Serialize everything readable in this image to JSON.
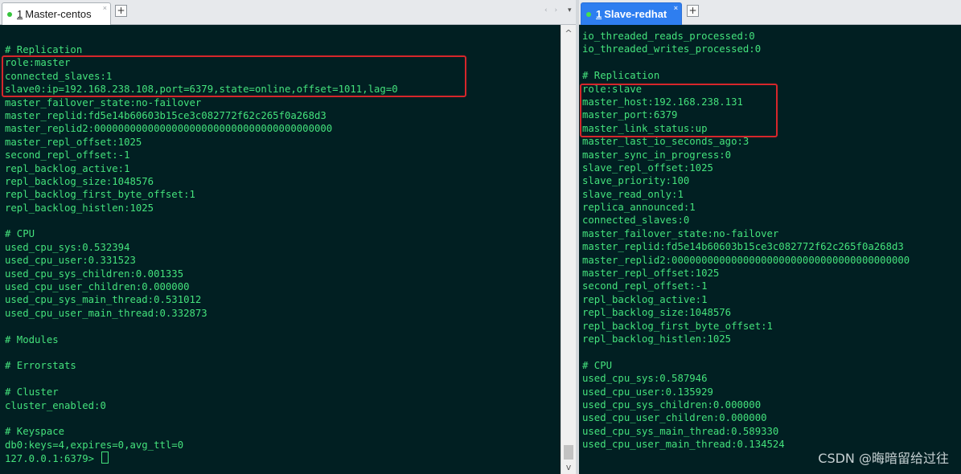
{
  "left": {
    "tab": {
      "number": "1",
      "title": "Master-centos",
      "close": "×"
    },
    "add_tab": "+",
    "tab_nav": "‹ ›",
    "tab_menu": "▾",
    "lines": [
      "# Replication",
      "role:master",
      "connected_slaves:1",
      "slave0:ip=192.168.238.108,port=6379,state=online,offset=1011,lag=0",
      "master_failover_state:no-failover",
      "master_replid:fd5e14b60603b15ce3c082772f62c265f0a268d3",
      "master_replid2:0000000000000000000000000000000000000000",
      "master_repl_offset:1025",
      "second_repl_offset:-1",
      "repl_backlog_active:1",
      "repl_backlog_size:1048576",
      "repl_backlog_first_byte_offset:1",
      "repl_backlog_histlen:1025",
      "",
      "# CPU",
      "used_cpu_sys:0.532394",
      "used_cpu_user:0.331523",
      "used_cpu_sys_children:0.001335",
      "used_cpu_user_children:0.000000",
      "used_cpu_sys_main_thread:0.531012",
      "used_cpu_user_main_thread:0.332873",
      "",
      "# Modules",
      "",
      "# Errorstats",
      "",
      "# Cluster",
      "cluster_enabled:0",
      "",
      "# Keyspace",
      "db0:keys=4,expires=0,avg_ttl=0"
    ],
    "prompt": "127.0.0.1:6379> "
  },
  "right": {
    "tab": {
      "number": "1",
      "title": "Slave-redhat",
      "close": "×"
    },
    "add_tab": "+",
    "lines": [
      "io_threaded_reads_processed:0",
      "io_threaded_writes_processed:0",
      "",
      "# Replication",
      "role:slave",
      "master_host:192.168.238.131",
      "master_port:6379",
      "master_link_status:up",
      "master_last_io_seconds_ago:3",
      "master_sync_in_progress:0",
      "slave_repl_offset:1025",
      "slave_priority:100",
      "slave_read_only:1",
      "replica_announced:1",
      "connected_slaves:0",
      "master_failover_state:no-failover",
      "master_replid:fd5e14b60603b15ce3c082772f62c265f0a268d3",
      "master_replid2:0000000000000000000000000000000000000000",
      "master_repl_offset:1025",
      "second_repl_offset:-1",
      "repl_backlog_active:1",
      "repl_backlog_size:1048576",
      "repl_backlog_first_byte_offset:1",
      "repl_backlog_histlen:1025",
      "",
      "# CPU",
      "used_cpu_sys:0.587946",
      "used_cpu_user:0.135929",
      "used_cpu_sys_children:0.000000",
      "used_cpu_user_children:0.000000",
      "used_cpu_sys_main_thread:0.589330",
      "used_cpu_user_main_thread:0.134524"
    ]
  },
  "scrollbar": {
    "up": "^",
    "down": "v"
  },
  "watermark": "CSDN @晦暗留给过往",
  "colors": {
    "terminal_bg": "#011f22",
    "terminal_text": "#44e27c",
    "highlight_box": "#d6262b",
    "active_tab": "#2e7ef0"
  }
}
